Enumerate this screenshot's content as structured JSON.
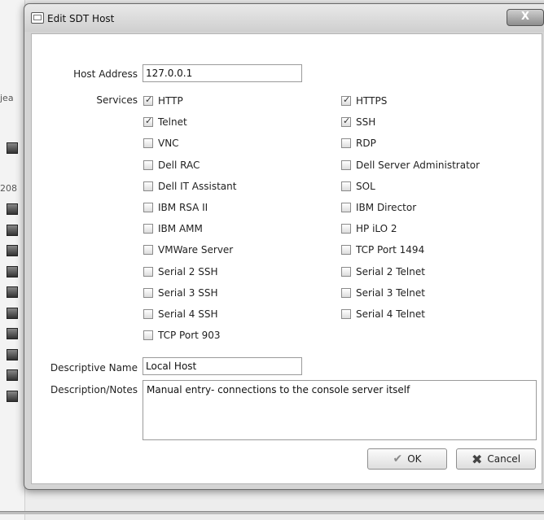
{
  "dialog": {
    "title": "Edit SDT Host",
    "close_label": "X"
  },
  "form": {
    "host_address_label": "Host Address",
    "host_address_value": "127.0.0.1",
    "services_label": "Services",
    "descriptive_name_label": "Descriptive Name",
    "descriptive_name_value": "Local Host",
    "notes_label": "Description/Notes",
    "notes_value": "Manual entry- connections to the console server itself"
  },
  "services_left": [
    {
      "label": "HTTP",
      "checked": true
    },
    {
      "label": "Telnet",
      "checked": true
    },
    {
      "label": "VNC",
      "checked": false
    },
    {
      "label": "Dell RAC",
      "checked": false
    },
    {
      "label": "Dell IT Assistant",
      "checked": false
    },
    {
      "label": "IBM RSA II",
      "checked": false
    },
    {
      "label": "IBM AMM",
      "checked": false
    },
    {
      "label": "VMWare Server",
      "checked": false
    },
    {
      "label": "Serial 2 SSH",
      "checked": false
    },
    {
      "label": "Serial 3 SSH",
      "checked": false
    },
    {
      "label": "Serial 4 SSH",
      "checked": false
    },
    {
      "label": "TCP Port 903",
      "checked": false
    }
  ],
  "services_right": [
    {
      "label": "HTTPS",
      "checked": true
    },
    {
      "label": "SSH",
      "checked": true
    },
    {
      "label": "RDP",
      "checked": false
    },
    {
      "label": "Dell Server Administrator",
      "checked": false
    },
    {
      "label": "SOL",
      "checked": false
    },
    {
      "label": "IBM Director",
      "checked": false
    },
    {
      "label": "HP iLO 2",
      "checked": false
    },
    {
      "label": "TCP Port 1494",
      "checked": false
    },
    {
      "label": "Serial 2 Telnet",
      "checked": false
    },
    {
      "label": "Serial 3 Telnet",
      "checked": false
    },
    {
      "label": "Serial 4 Telnet",
      "checked": false
    }
  ],
  "buttons": {
    "ok_label": "OK",
    "cancel_label": "Cancel"
  },
  "background": {
    "fragment_1": "jea",
    "fragment_2": "208"
  }
}
